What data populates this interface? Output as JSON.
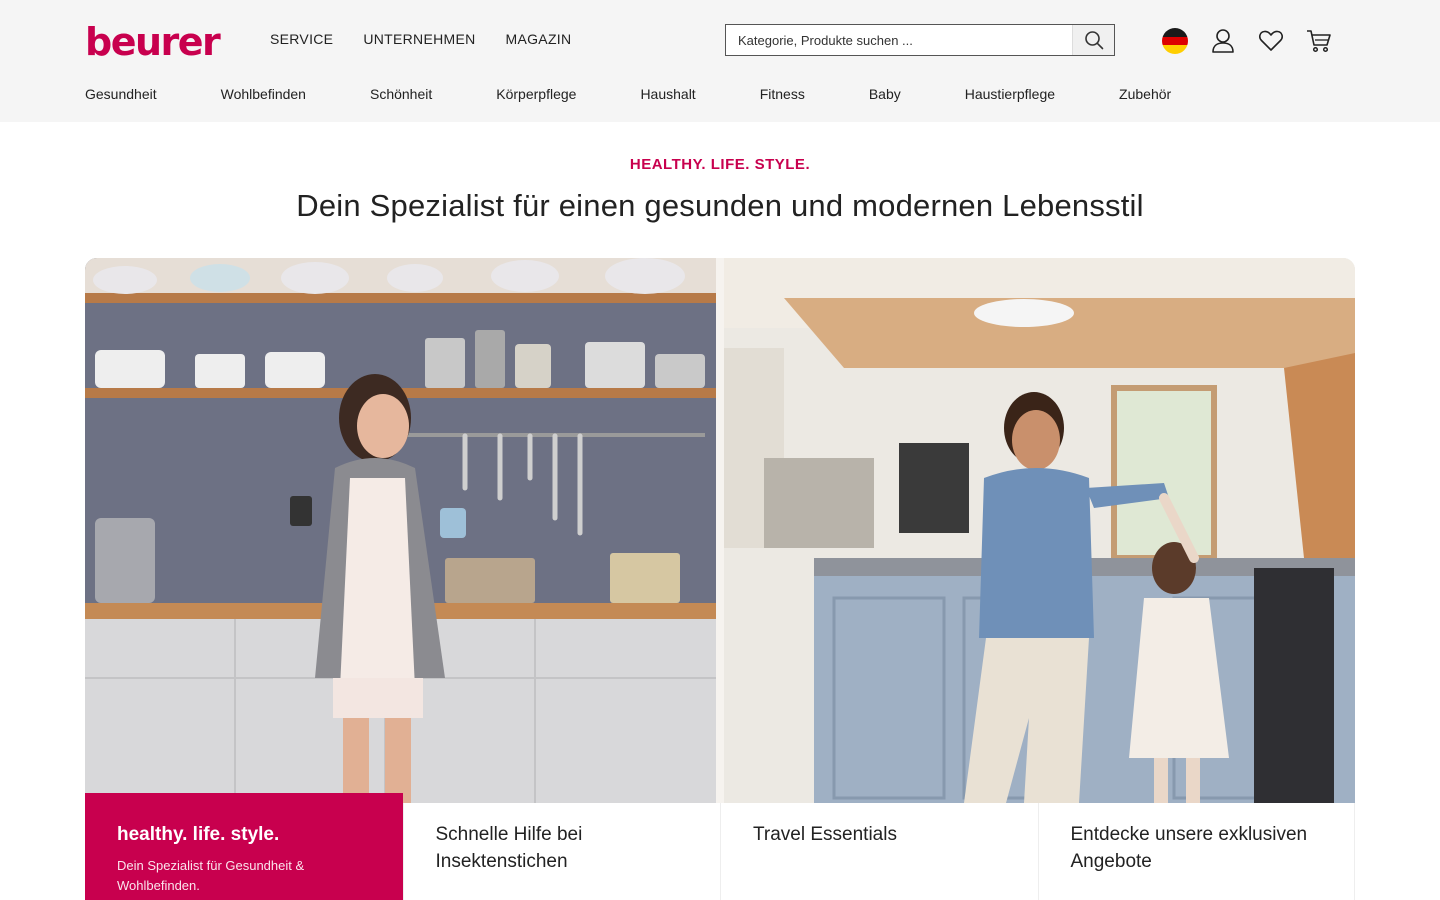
{
  "brand": {
    "logo_text": "beurer",
    "accent_color": "#c8004e"
  },
  "topnav": [
    "SERVICE",
    "UNTERNEHMEN",
    "MAGAZIN"
  ],
  "search": {
    "placeholder": "Kategorie, Produkte suchen ...",
    "icon": "search-icon"
  },
  "header_icons": [
    "flag-de-icon",
    "user-icon",
    "heart-icon",
    "cart-icon"
  ],
  "categories": [
    "Gesundheit",
    "Wohlbefinden",
    "Schönheit",
    "Körperpflege",
    "Haushalt",
    "Fitness",
    "Baby",
    "Haustierpflege",
    "Zubehör"
  ],
  "hero": {
    "eyebrow": "HEALTHY. LIFE. STYLE.",
    "headline": "Dein Spezialist für einen gesunden und modernen Lebensstil"
  },
  "cards": [
    {
      "title": "healthy. life. style.",
      "text": "Dein Spezialist für Gesundheit & Wohlbefinden."
    },
    {
      "title": "Schnelle Hilfe bei Insektenstichen"
    },
    {
      "title": "Travel Essentials"
    },
    {
      "title": "Entdecke unsere exklusiven Angebote"
    }
  ]
}
